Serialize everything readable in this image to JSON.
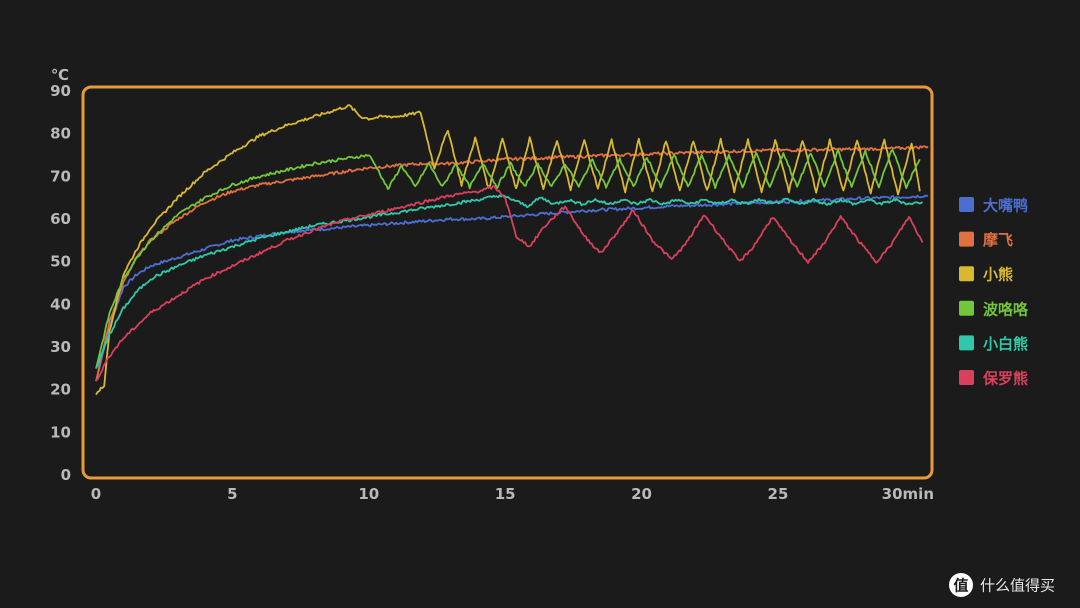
{
  "chart_data": {
    "type": "line",
    "title": "",
    "ylabel": "℃",
    "xlabel": "",
    "ylim": [
      0,
      90
    ],
    "xlim": [
      0,
      30.5
    ],
    "yticks": [
      0,
      10,
      20,
      30,
      40,
      50,
      60,
      70,
      80,
      90
    ],
    "yticklabels": [
      "0",
      "10",
      "20",
      "30",
      "40",
      "50",
      "60",
      "70",
      "80",
      "90"
    ],
    "xticks": [
      0,
      5,
      10,
      15,
      20,
      25,
      30
    ],
    "xticklabels": [
      "0",
      "5",
      "10",
      "15",
      "20",
      "25",
      "30min"
    ],
    "grid": false,
    "legend": "right",
    "frame_color": "#e8993a",
    "series": [
      {
        "name": "大嘴鸭",
        "color": "#4a6fd1",
        "x": [
          0,
          0.5,
          1,
          1.5,
          2,
          3,
          4,
          5,
          6,
          7,
          8,
          9,
          10,
          11,
          12,
          13,
          14,
          15,
          16,
          17,
          18,
          19,
          20,
          21,
          22,
          23,
          24,
          25,
          26,
          27,
          28,
          29,
          30,
          30.5
        ],
        "y": [
          22,
          35,
          44,
          47,
          49,
          51,
          53,
          55,
          56,
          57,
          57.5,
          58,
          58.5,
          59,
          59.5,
          60,
          60,
          60.5,
          61,
          61.5,
          62,
          62.3,
          62.6,
          63,
          63.2,
          63.5,
          63.8,
          64,
          64.2,
          64.5,
          64.8,
          65,
          65.3,
          65.5
        ]
      },
      {
        "name": "摩飞",
        "color": "#e07040",
        "x": [
          0,
          0.5,
          1,
          1.5,
          2,
          3,
          4,
          5,
          6,
          7,
          8,
          9,
          10,
          11,
          12,
          13,
          14,
          15,
          16,
          17,
          18,
          19,
          20,
          21,
          22,
          23,
          24,
          25,
          26,
          27,
          28,
          29,
          30,
          30.5
        ],
        "y": [
          22,
          36,
          45,
          51,
          55,
          60,
          64,
          66.5,
          68,
          69,
          70,
          71,
          72,
          72.5,
          73,
          73,
          73.5,
          74,
          74.2,
          74.5,
          74.7,
          75,
          75.2,
          75.4,
          75.6,
          75.8,
          76,
          76.1,
          76.2,
          76.3,
          76.4,
          76.5,
          76.7,
          77
        ]
      },
      {
        "name": "小熊",
        "color": "#d8b830",
        "x": [
          0,
          0.3,
          0.5,
          1,
          1.5,
          2,
          3,
          4,
          5,
          6,
          7,
          8,
          9,
          9.3,
          9.7,
          10,
          10.5,
          11,
          11.5,
          11.9,
          12.4,
          12.9,
          13.4,
          13.9,
          14.4,
          14.9,
          15.4,
          15.9,
          16.4,
          16.9,
          17.4,
          17.9,
          18.4,
          18.9,
          19.4,
          19.9,
          20.4,
          20.9,
          21.4,
          21.9,
          22.4,
          22.9,
          23.4,
          23.9,
          24.4,
          24.9,
          25.4,
          25.9,
          26.4,
          26.9,
          27.4,
          27.9,
          28.4,
          28.9,
          29.4,
          29.9,
          30.2
        ],
        "y": [
          19,
          21,
          34,
          47,
          53,
          58,
          65,
          71,
          75.5,
          79.5,
          82,
          84,
          86,
          86.5,
          84,
          83.5,
          84,
          84,
          84.5,
          85,
          72,
          81,
          68,
          79,
          67,
          79,
          67,
          79,
          67,
          78.5,
          67,
          78.5,
          67,
          78.5,
          66.5,
          78.5,
          66.5,
          78.5,
          66.5,
          78.5,
          66.5,
          78.5,
          66.5,
          78.5,
          66.5,
          78.5,
          66.5,
          78.5,
          66.5,
          78.5,
          66.5,
          78.5,
          66,
          78.5,
          66,
          78,
          66.5
        ]
      },
      {
        "name": "波咯咯",
        "color": "#72c63a",
        "x": [
          0,
          0.5,
          1,
          1.5,
          2,
          3,
          4,
          5,
          6,
          7,
          8,
          9,
          9.5,
          10,
          10.3,
          10.7,
          11.2,
          11.7,
          12.2,
          12.7,
          13.2,
          13.7,
          14.2,
          14.7,
          15.2,
          15.7,
          16.2,
          16.7,
          17.2,
          17.7,
          18.2,
          18.7,
          19.2,
          19.7,
          20.2,
          20.7,
          21.2,
          21.7,
          22.2,
          22.7,
          23.2,
          23.7,
          24.2,
          24.7,
          25.2,
          25.7,
          26.2,
          26.7,
          27.2,
          27.7,
          28.2,
          28.7,
          29.2,
          29.7,
          30.2
        ],
        "y": [
          25,
          38,
          46,
          51,
          55,
          61,
          65,
          68,
          70,
          71.5,
          73,
          74,
          74.5,
          75,
          72,
          67,
          72.5,
          67.5,
          73,
          67.5,
          73,
          67.5,
          73,
          67.5,
          73,
          67.5,
          73,
          67.5,
          73,
          67.5,
          74,
          67.5,
          74,
          67.5,
          74.5,
          67.5,
          75,
          67.5,
          75,
          67.5,
          75,
          67.5,
          75.5,
          67.5,
          75.5,
          67.5,
          75.5,
          67.5,
          76,
          67.5,
          76,
          67.5,
          76.5,
          67.5,
          74
        ]
      },
      {
        "name": "小白熊",
        "color": "#30c8a8",
        "x": [
          0,
          0.5,
          1,
          1.5,
          2,
          3,
          4,
          5,
          6,
          7,
          8,
          9,
          10,
          11,
          12,
          13,
          14,
          14.8,
          15.3,
          15.8,
          16.3,
          16.8,
          17.3,
          17.8,
          18.3,
          18.8,
          19.3,
          19.8,
          20.3,
          20.8,
          21.3,
          21.8,
          22.3,
          22.8,
          23.3,
          23.8,
          24.3,
          24.8,
          25.3,
          25.8,
          26.3,
          26.8,
          27.3,
          27.8,
          28.3,
          28.8,
          29.3,
          29.8,
          30.3
        ],
        "y": [
          25,
          33,
          39,
          43,
          46,
          49,
          51.5,
          53.5,
          55.5,
          57,
          58.5,
          59.5,
          60.5,
          61.5,
          62.5,
          63.5,
          64.5,
          65.5,
          64.5,
          63,
          65,
          63.5,
          64.5,
          63.5,
          64.5,
          63.5,
          64.5,
          63.5,
          64.5,
          63.5,
          64.5,
          63.5,
          64.5,
          63.5,
          64.5,
          63.5,
          64.5,
          63.5,
          64.5,
          63.5,
          64.5,
          63.5,
          64.5,
          63.5,
          64.5,
          63.5,
          64.5,
          63.5,
          64
        ]
      },
      {
        "name": "保罗熊",
        "color": "#d8405c",
        "x": [
          0,
          0.5,
          1,
          1.5,
          2,
          3,
          4,
          5,
          6,
          7,
          8,
          9,
          10,
          11,
          12,
          13,
          14,
          14.6,
          15,
          15.4,
          15.9,
          16.4,
          17.2,
          17.9,
          18.5,
          19,
          19.7,
          20.4,
          21.1,
          21.6,
          22.3,
          23,
          23.6,
          24.1,
          24.8,
          25.5,
          26.1,
          26.6,
          27.3,
          28,
          28.6,
          29.1,
          29.8,
          30.3
        ],
        "y": [
          22,
          28,
          32,
          35,
          38,
          42,
          46,
          49,
          52,
          55,
          57.5,
          59.5,
          61,
          62.5,
          64,
          65.5,
          66.5,
          67.5,
          65,
          56,
          53.5,
          58,
          63,
          56,
          52,
          56,
          62,
          55,
          50.5,
          54,
          61,
          55,
          50,
          53.5,
          60.5,
          54.5,
          50,
          53.5,
          60.5,
          54.5,
          50,
          53.5,
          60.5,
          54.5
        ]
      }
    ]
  },
  "watermark": {
    "icon": "值-logo-icon",
    "text": "什么值得买"
  },
  "colors": {
    "background": "#1b1b1b",
    "frame": "#e8993a",
    "tick_text": "#b9b9b9"
  }
}
